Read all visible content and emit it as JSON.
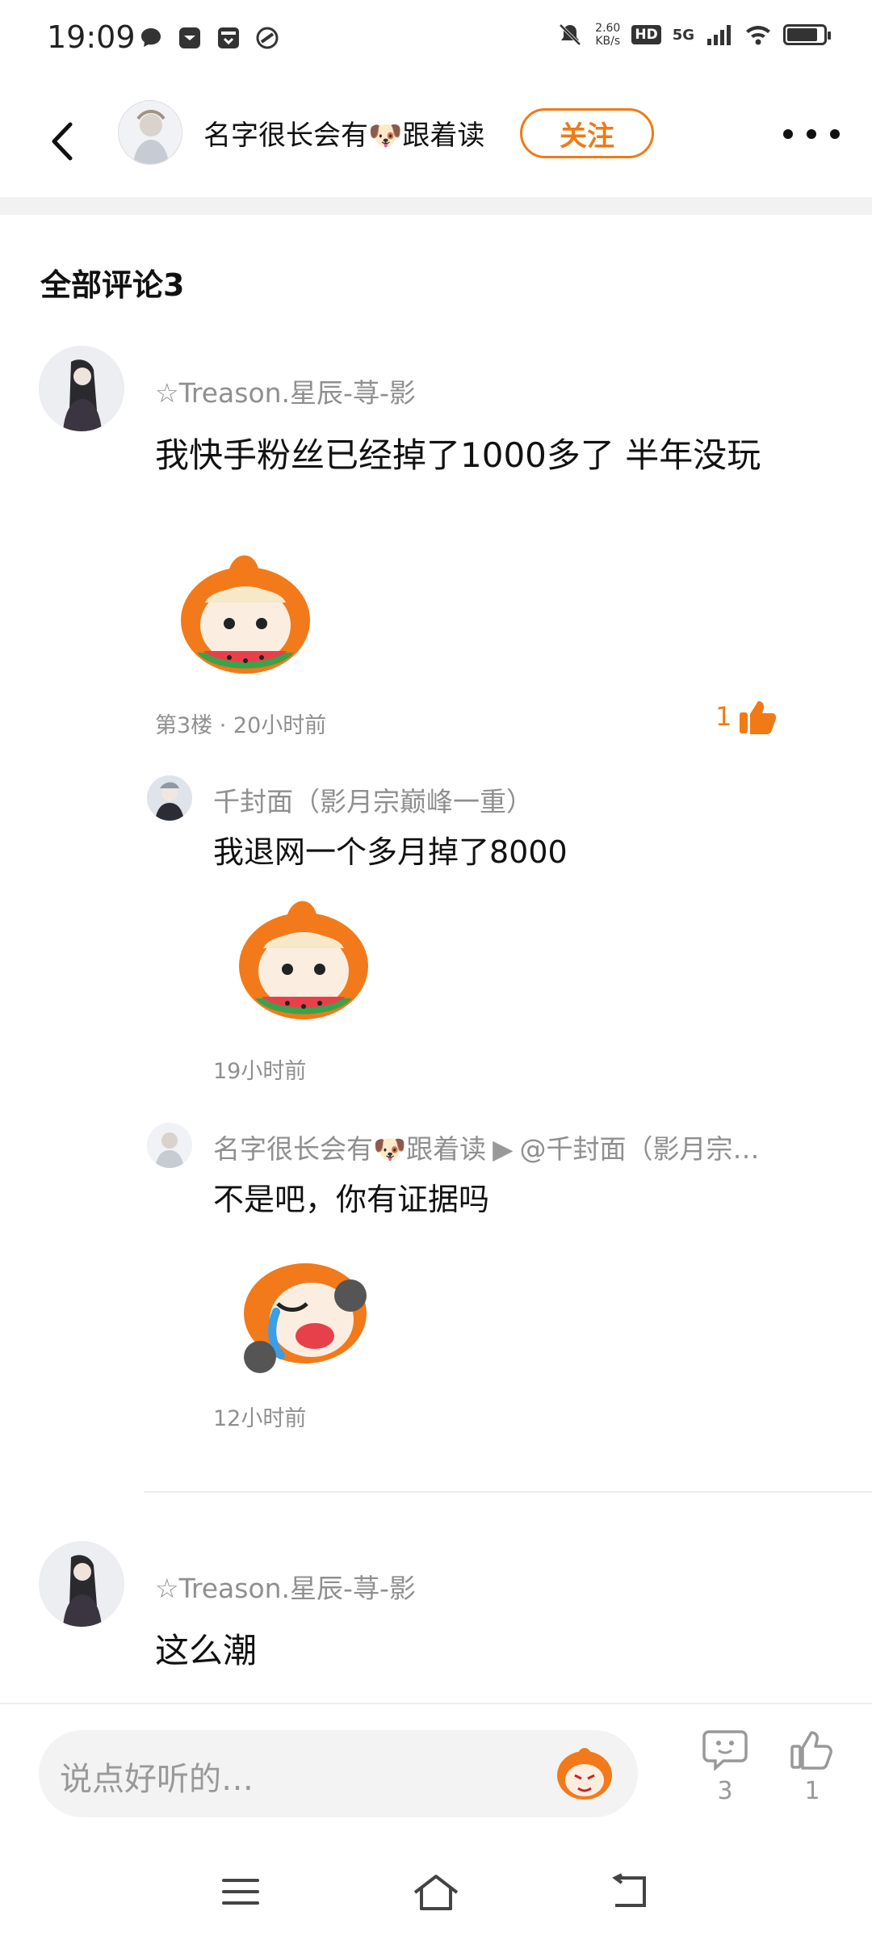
{
  "status": {
    "time": "19:09",
    "net_speed_value": "2.60",
    "net_speed_unit": "KB/s",
    "hd": "HD",
    "network": "5G",
    "battery_level": 0.85
  },
  "header": {
    "name": "名字很长会有🐶跟着读",
    "follow_label": "关注"
  },
  "section": {
    "title": "全部评论3"
  },
  "comments": [
    {
      "user": "☆Treason.星辰-荨-影",
      "text": "我快手粉丝已经掉了1000多了 半年没玩",
      "meta": "第3楼 · 20小时前",
      "likes": "1",
      "replies": [
        {
          "user": "千封面（影月宗巅峰一重）",
          "text": "我退网一个多月掉了8000",
          "time": "19小时前"
        },
        {
          "user": "名字很长会有🐶跟着读",
          "reply_to": "@千封面（影月宗…",
          "text": "不是吧，你有证据吗",
          "time": "12小时前"
        }
      ]
    },
    {
      "user": "☆Treason.星辰-荨-影",
      "text": "这么潮"
    }
  ],
  "bottom": {
    "placeholder": "说点好听的…",
    "comment_count": "3",
    "like_count": "1"
  },
  "colors": {
    "accent": "#f07a16",
    "muted_text": "#8f8f8f"
  }
}
